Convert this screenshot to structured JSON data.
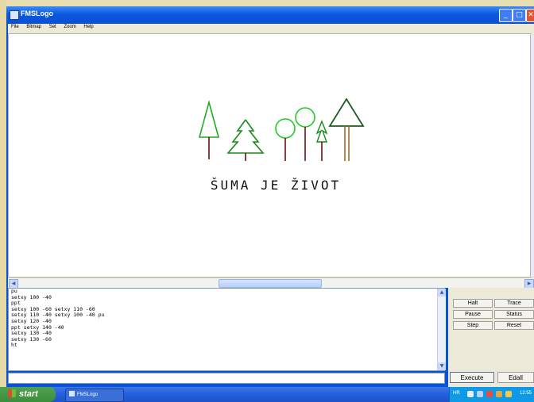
{
  "window": {
    "title": "FMSLogo"
  },
  "menu": [
    "File",
    "Bitmap",
    "Set",
    "Zoom",
    "Help"
  ],
  "canvas": {
    "slogan": "ŠUMA JE ŽIVOT"
  },
  "commander": {
    "history": [
      "pu",
      "setxy 100 -40",
      "ppt",
      "setxy 100 -60 setxy 110 -60",
      "setxy 110 -40 setxy 100 -40 pu",
      "setxy 120 -40",
      "ppt setxy 140 -40",
      "setxy 130 -40",
      "setxy 130 -60",
      "ht"
    ],
    "input_value": "",
    "buttons": {
      "halt": "Halt",
      "trace": "Trace",
      "pause": "Pause",
      "status": "Status",
      "step": "Step",
      "reset": "Reset",
      "execute": "Execute",
      "edall": "Edall"
    }
  },
  "taskbar": {
    "start_label": "start",
    "task_label": "FMSLogo",
    "tray_lang": "HR",
    "clock": "12:55"
  },
  "icons": {
    "app": "app-icon",
    "minimize": "minimize-icon",
    "maximize": "maximize-icon",
    "close": "close-icon"
  },
  "colors": {
    "tree_green": "#1a8a1a",
    "bright_green": "#22cc22",
    "dark_green": "#1e5a1e",
    "trunk_red": "#6b1010",
    "trunk_brown": "#a0692a"
  }
}
